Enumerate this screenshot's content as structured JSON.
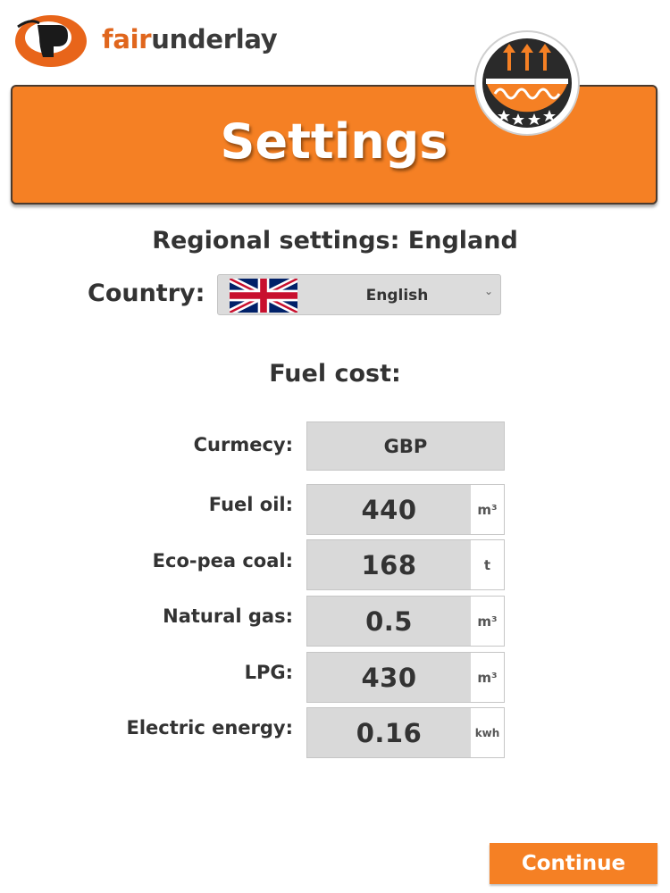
{
  "brand": {
    "fair": "fair",
    "underlay": "underlay",
    "logo_icon": "fairunderlay-logo-icon"
  },
  "header": {
    "title": "Settings",
    "badge_icon": "underfloor-heating-badge-icon"
  },
  "regional": {
    "heading": "Regional settings: England",
    "country_label": "Country:",
    "country_value": "English",
    "flag_icon": "uk-flag-icon"
  },
  "fuel": {
    "heading": "Fuel cost:",
    "currency_label": "Curmecy:",
    "currency_value": "GBP",
    "rows": [
      {
        "label": "Fuel oil:",
        "value": "440",
        "unit": "m³"
      },
      {
        "label": "Eco-pea coal:",
        "value": "168",
        "unit": "t"
      },
      {
        "label": "Natural gas:",
        "value": "0.5",
        "unit": "m³"
      },
      {
        "label": "LPG:",
        "value": "430",
        "unit": "m³"
      },
      {
        "label": "Electric energy:",
        "value": "0.16",
        "unit": "kwh"
      }
    ]
  },
  "actions": {
    "continue_label": "Continue"
  },
  "colors": {
    "accent": "#f58024",
    "text": "#333333",
    "field": "#d9d9d9"
  }
}
